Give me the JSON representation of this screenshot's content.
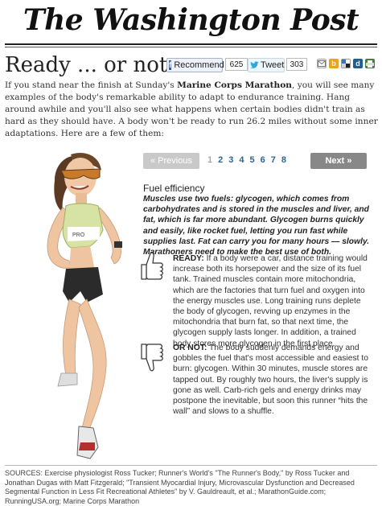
{
  "masthead": {
    "title": "The Washington Post"
  },
  "headline": "Ready ... or not",
  "share": {
    "facebook_label": "Recommend",
    "facebook_count": "625",
    "twitter_label": "Tweet",
    "twitter_count": "303",
    "icons": [
      "email-icon",
      "buzz-icon",
      "delicious-icon",
      "digg-icon",
      "print-icon"
    ]
  },
  "intro": {
    "part1": "If you stand near the finish at Sunday's ",
    "bold": "Marine Corps Marathon",
    "part2": ", you will see many examples of the body's remarkable ability to adapt to endurance training.  Hang around awhile and you'll also see what happens when certain bodies didn't train as hard as they should have. A body won't be ready to run 26.2 miles without some inner adaptations.  Here are a few of them:"
  },
  "pager": {
    "prev": "« Previous",
    "next": "Next »",
    "pages": [
      "1",
      "2",
      "3",
      "4",
      "5",
      "6",
      "7",
      "8"
    ]
  },
  "section": {
    "title": "Fuel efficiency",
    "lead": "Muscles use two fuels: glycogen, which comes from carbohydrates and is stored in the muscles and liver, and fat, which is far more abundant. Glycogen burns quickly and easily, like rocket fuel, letting you run fast while supplies last. Fat can carry you for many hours — slowly. Marathoners need to make the best use of both.",
    "ready_label": "READY:",
    "ready_text": " If a body were a car, distance training would increase both its horsepower and the size of its fuel tank. Trained muscles contain more mitochondria, which are the factories that turn fuel and oxygen into the energy muscles use. Long training runs deplete the body of glycogen, revving up enzymes in the mitochondria that burn fat, so that next time, the glycogen supply lasts longer. In addition, a trained body stores more glycogen in the first place.",
    "notready_label": "OR NOT:",
    "notready_text": " The body suddenly demands energy and gobbles the fuel that's most accessible and easiest to burn: glycogen. Within 30 minutes, muscle stores are tapped out. By roughly two hours, the liver's supply is gone as well. Carb-rich gels and energy drinks may postpone the inevitable, but soon this runner “hits the wall” and slows to a shuffle."
  },
  "sources": "SOURCES: Exercise physiologist Ross Tucker; Runner's World's \"The Runner's Body,\" by Ross Tucker and Jonathan Dugas with Matt Fitzgerald; \"Transient Myocardial Injury, Microvascular Dysfunction and Decreased Segmental Function in Less Fit Recreational Athletes\" by V. Gauldreault, et al.; MarathonGuide.com; RunningUSA.org; Marine Corps Marathon",
  "colors": {
    "link": "#2a6496",
    "facebook": "#3b5998",
    "twitter": "#2fa8e0",
    "next_button": "#888888",
    "prev_button": "#c9c9c9"
  }
}
